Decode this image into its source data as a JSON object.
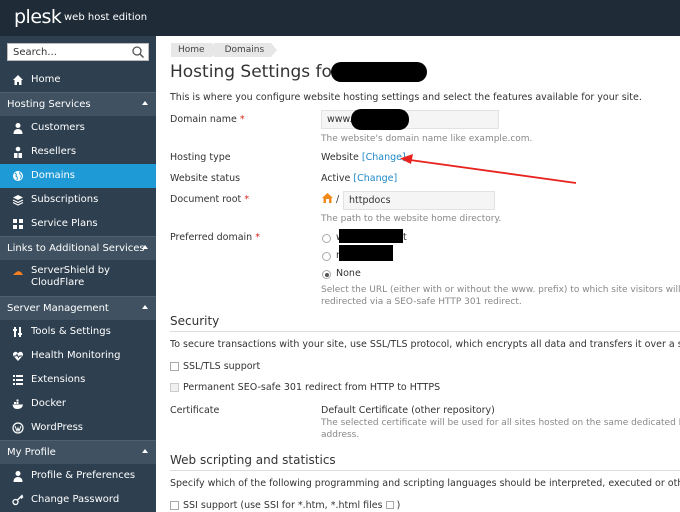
{
  "app": {
    "logo": "plesk",
    "edition": "web host edition"
  },
  "sidebar": {
    "search_placeholder": "Search...",
    "items": [
      {
        "label": "Home",
        "icon": "home-icon"
      },
      {
        "section": "Hosting Services"
      },
      {
        "label": "Customers",
        "icon": "customer-icon"
      },
      {
        "label": "Resellers",
        "icon": "reseller-icon"
      },
      {
        "label": "Domains",
        "icon": "globe-icon",
        "active": true
      },
      {
        "label": "Subscriptions",
        "icon": "subscription-icon"
      },
      {
        "label": "Service Plans",
        "icon": "service-plans-icon"
      },
      {
        "section": "Links to Additional Services"
      },
      {
        "label": "ServerShield by CloudFlare",
        "icon": "cloudflare-icon"
      },
      {
        "section": "Server Management"
      },
      {
        "label": "Tools & Settings",
        "icon": "tools-icon"
      },
      {
        "label": "Health Monitoring",
        "icon": "heart-icon"
      },
      {
        "label": "Extensions",
        "icon": "extensions-icon"
      },
      {
        "label": "Docker",
        "icon": "docker-icon"
      },
      {
        "label": "WordPress",
        "icon": "wordpress-icon"
      },
      {
        "section": "My Profile"
      },
      {
        "label": "Profile & Preferences",
        "icon": "profile-icon"
      },
      {
        "label": "Change Password",
        "icon": "key-icon"
      }
    ]
  },
  "breadcrumbs": [
    "Home",
    "Domains"
  ],
  "page": {
    "title": "Hosting Settings for",
    "description": "This is where you configure website hosting settings and select the features available for your site."
  },
  "form": {
    "domain_name": {
      "label": "Domain name",
      "required": "*",
      "prefix": "www.",
      "hint": "The website's domain name like example.com."
    },
    "hosting_type": {
      "label": "Hosting type",
      "value": "Website",
      "link": "[Change]"
    },
    "website_status": {
      "label": "Website status",
      "value": "Active",
      "link": "[Change]"
    },
    "document_root": {
      "label": "Document root",
      "required": "*",
      "slash": "/",
      "value": "httpdocs",
      "hint": "The path to the website home directory."
    },
    "preferred_domain": {
      "label": "Preferred domain",
      "required": "*",
      "options": [
        {
          "prefix": "w",
          "suffix": "t",
          "checked": false
        },
        {
          "prefix": "n",
          "checked": false
        },
        {
          "label": "None",
          "checked": true
        }
      ],
      "hint_line1": "Select the URL (either with or without the www. prefix) to which site visitors will be",
      "hint_line2": "redirected via a SEO-safe HTTP 301 redirect."
    }
  },
  "security": {
    "title": "Security",
    "description": "To secure transactions with your site, use SSL/TLS protocol, which encrypts all data and transfers it over a secure conne",
    "ssl_label": "SSL/TLS support",
    "redirect_label": "Permanent SEO-safe 301 redirect from HTTP to HTTPS",
    "certificate_label": "Certificate",
    "certificate_value": "Default Certificate (other repository)",
    "certificate_hint_line1": "The selected certificate will be used for all sites hosted on the same dedicated IP",
    "certificate_hint_line2": "address."
  },
  "scripting": {
    "title": "Web scripting and statistics",
    "description": "Specify which of the following programming and scripting languages should be interpreted, executed or otherwise proc",
    "ssi_label": "SSI support (use SSI for *.htm, *.html files"
  },
  "colors": {
    "topbar": "#1f2b37",
    "sidebar": "#2e3f4f",
    "active": "#1e9ad6",
    "link": "#1e88c6",
    "required": "#d9261c",
    "annotation_arrow": "#e8231f"
  }
}
